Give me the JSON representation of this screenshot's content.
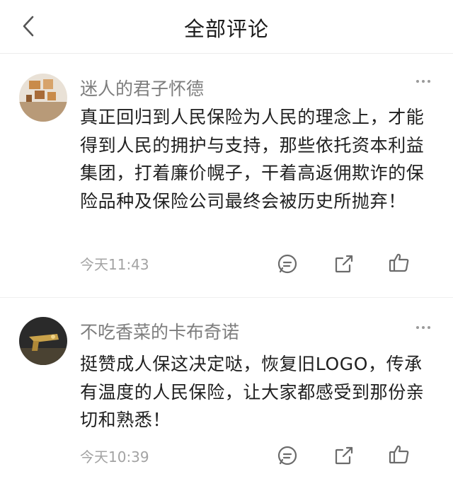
{
  "header": {
    "title": "全部评论"
  },
  "comments": [
    {
      "username": "迷人的君子怀德",
      "text": "真正回归到人民保险为人民的理念上，才能得到人民的拥护与支持，那些依托资本利益集团，打着廉价幌子，干着高返佣欺诈的保险品种及保险公司最终会被历史所抛弃！",
      "time": "今天11:43"
    },
    {
      "username": "不吃香菜的卡布奇诺",
      "text": "挺赞成人保这决定哒，恢复旧LOGO，传承有温度的人民保险，让大家都感受到那份亲切和熟悉！",
      "time": "今天10:39"
    }
  ],
  "icons": {
    "back": "chevron-left-icon",
    "more": "ellipsis-icon",
    "reply": "comment-bubble-icon",
    "share": "share-arrow-icon",
    "like": "thumbs-up-icon"
  }
}
